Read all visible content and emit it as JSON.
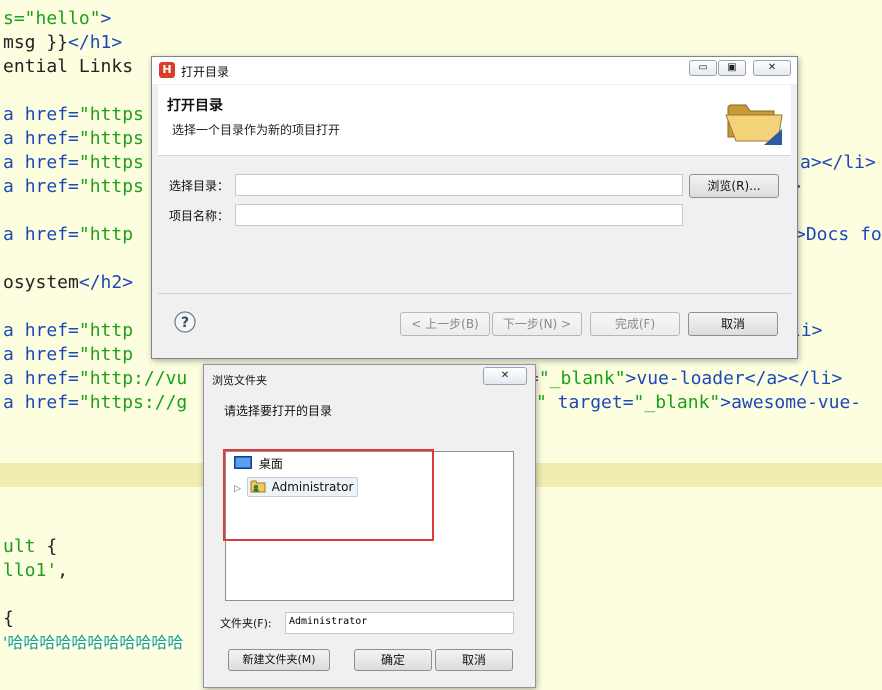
{
  "editor": {
    "lines": [
      {
        "parts": [
          [
            "c-str",
            "s=\"hello\""
          ],
          [
            "c-tag",
            ">"
          ]
        ]
      },
      {
        "parts": [
          [
            "c-txt",
            "msg }}"
          ],
          [
            "c-tag",
            "</h1>"
          ]
        ]
      },
      {
        "parts": [
          [
            "c-txt",
            "ential Links"
          ]
        ]
      },
      {
        "parts": []
      },
      {
        "parts": [
          [
            "c-attr",
            "a "
          ],
          [
            "c-attr",
            "href="
          ],
          [
            "c-str",
            "\"https"
          ]
        ]
      },
      {
        "parts": [
          [
            "c-attr",
            "a "
          ],
          [
            "c-attr",
            "href="
          ],
          [
            "c-str",
            "\"https"
          ]
        ]
      },
      {
        "parts": [
          [
            "c-attr",
            "a "
          ],
          [
            "c-attr",
            "href="
          ],
          [
            "c-str",
            "\"https"
          ]
        ]
      },
      {
        "parts": [
          [
            "c-attr",
            "a "
          ],
          [
            "c-attr",
            "href="
          ],
          [
            "c-str",
            "\"https"
          ]
        ]
      },
      {
        "parts": []
      },
      {
        "parts": [
          [
            "c-attr",
            "a "
          ],
          [
            "c-attr",
            "href="
          ],
          [
            "c-str",
            "\"http"
          ]
        ]
      },
      {
        "parts": []
      },
      {
        "parts": [
          [
            "c-txt",
            "osystem"
          ],
          [
            "c-tag",
            "</h2>"
          ]
        ]
      },
      {
        "parts": []
      },
      {
        "parts": [
          [
            "c-attr",
            "a "
          ],
          [
            "c-attr",
            "href="
          ],
          [
            "c-str",
            "\"http"
          ]
        ]
      },
      {
        "parts": [
          [
            "c-attr",
            "a "
          ],
          [
            "c-attr",
            "href="
          ],
          [
            "c-str",
            "\"http"
          ]
        ]
      },
      {
        "parts": [
          [
            "c-attr",
            "a "
          ],
          [
            "c-attr",
            "href="
          ],
          [
            "c-str",
            "\"http://vu"
          ]
        ]
      },
      {
        "parts": [
          [
            "c-attr",
            "a "
          ],
          [
            "c-attr",
            "href="
          ],
          [
            "c-str",
            "\"https://g"
          ]
        ]
      }
    ],
    "right_fragments": [
      {
        "line": 6,
        "text": "a></li>"
      },
      {
        "line": 7,
        "text": ">"
      },
      {
        "line": 9,
        "text": ">Docs fo"
      },
      {
        "line": 13,
        "text": "li>"
      }
    ],
    "vue_loader_line": {
      "q": "\"_blank\"",
      "rest": ">vue-loader</a></li>",
      "eq": "=",
      "tag": "tag"
    },
    "awesome_line": {
      "q": "\"",
      "target": " target=",
      "val": "\"_blank\"",
      "rest": ">awesome-vue-"
    },
    "lower_lines": [
      {
        "line": 22,
        "parts": [
          [
            "c-str",
            "ult "
          ],
          [
            "c-txt",
            "{"
          ]
        ]
      },
      {
        "line": 23,
        "parts": [
          [
            "c-str",
            "llo1'"
          ],
          [
            "c-txt",
            ","
          ]
        ]
      },
      {
        "line": 25,
        "parts": [
          [
            "c-txt",
            "{"
          ]
        ]
      },
      {
        "line": 26,
        "parts": [
          [
            "c-cn",
            "'哈哈哈哈哈哈哈哈哈哈哈"
          ]
        ]
      }
    ]
  },
  "open_dialog": {
    "title": "打开目录",
    "app_icon_letter": "H",
    "banner_title": "打开目录",
    "banner_subtitle": "选择一个目录作为新的项目打开",
    "dir_label": "选择目录：",
    "dir_value": "",
    "name_label": "项目名称：",
    "name_value": "",
    "browse_button": "浏览(R)...",
    "back_button": "< 上一步(B)",
    "next_button": "下一步(N) >",
    "finish_button": "完成(F)",
    "cancel_button": "取消",
    "help_icon": "?",
    "win_minimize": "▭",
    "win_restore": "▣",
    "win_close": "✕"
  },
  "browse_dialog": {
    "title": "浏览文件夹",
    "prompt": "请选择要打开的目录",
    "tree": [
      {
        "label": "桌面",
        "icon": "desktop-icon"
      },
      {
        "label": "Administrator",
        "icon": "user-folder-icon",
        "expand": "▷"
      }
    ],
    "folder_label": "文件夹(F):",
    "folder_value": "Administrator",
    "new_folder_button": "新建文件夹(M)",
    "ok_button": "确定",
    "cancel_button": "取消",
    "close_glyph": "✕"
  },
  "colors": {
    "highlight_border": "#e03b3b",
    "editor_bg": "#fdfde0",
    "tag_blue": "#1d48b8",
    "string_green": "#1aa11a"
  }
}
